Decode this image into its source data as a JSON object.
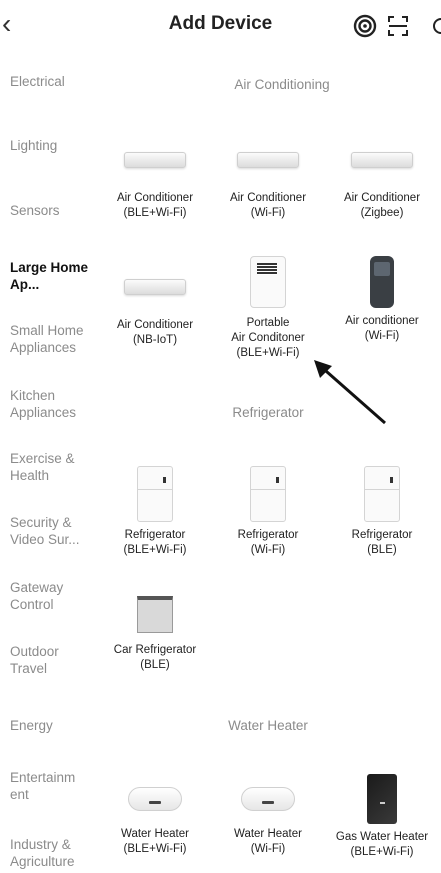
{
  "header": {
    "title": "Add Device"
  },
  "sidebar": {
    "items": [
      {
        "label": "Electrical",
        "active": false
      },
      {
        "label": "Lighting",
        "active": false
      },
      {
        "label": "Sensors",
        "active": false
      },
      {
        "label": "Large Home Ap...",
        "active": true
      },
      {
        "label": "Small Home Appliances",
        "active": false
      },
      {
        "label": "Kitchen Appliances",
        "active": false
      },
      {
        "label": "Exercise & Health",
        "active": false
      },
      {
        "label": "Security & Video Sur...",
        "active": false
      },
      {
        "label": "Gateway Control",
        "active": false
      },
      {
        "label": "Outdoor Travel",
        "active": false
      },
      {
        "label": "Energy",
        "active": false
      },
      {
        "label": "Entertainm ent",
        "active": false
      },
      {
        "label": "Industry & Agriculture",
        "active": false
      }
    ]
  },
  "sections": {
    "air_conditioning": {
      "title": "Air Conditioning",
      "items": [
        {
          "line1": "Air Conditioner",
          "line2": "(BLE+Wi-Fi)",
          "icon": "wall-ac-icon"
        },
        {
          "line1": "Air Conditioner",
          "line2": "(Wi-Fi)",
          "icon": "wall-ac-icon"
        },
        {
          "line1": "Air Conditioner",
          "line2": "(Zigbee)",
          "icon": "wall-ac-icon"
        },
        {
          "line1": "Air Conditioner",
          "line2": "(NB-IoT)",
          "icon": "wall-ac-icon"
        },
        {
          "line1": "Portable",
          "line2": "Air Conditoner",
          "line3": "(BLE+Wi-Fi)",
          "icon": "portable-ac-icon"
        },
        {
          "line1": "Air conditioner",
          "line2": "(Wi-Fi)",
          "icon": "ac-remote-icon"
        }
      ]
    },
    "refrigerator": {
      "title": "Refrigerator",
      "items": [
        {
          "line1": "Refrigerator",
          "line2": "(BLE+Wi-Fi)",
          "icon": "refrigerator-icon"
        },
        {
          "line1": "Refrigerator",
          "line2": "(Wi-Fi)",
          "icon": "refrigerator-icon"
        },
        {
          "line1": "Refrigerator",
          "line2": "(BLE)",
          "icon": "refrigerator-icon"
        },
        {
          "line1": "Car Refrigerator",
          "line2": "(BLE)",
          "icon": "car-refrigerator-icon"
        }
      ]
    },
    "water_heater": {
      "title": "Water Heater",
      "items": [
        {
          "line1": "Water Heater",
          "line2": "(BLE+Wi-Fi)",
          "icon": "water-heater-icon"
        },
        {
          "line1": "Water Heater",
          "line2": "(Wi-Fi)",
          "icon": "water-heater-icon"
        },
        {
          "line1": "Gas Water Heater",
          "line2": "(BLE+Wi-Fi)",
          "icon": "gas-water-heater-icon"
        }
      ]
    }
  },
  "colors": {
    "active_text": "#111111",
    "inactive_text": "#8b8b8b",
    "background": "#ffffff"
  }
}
